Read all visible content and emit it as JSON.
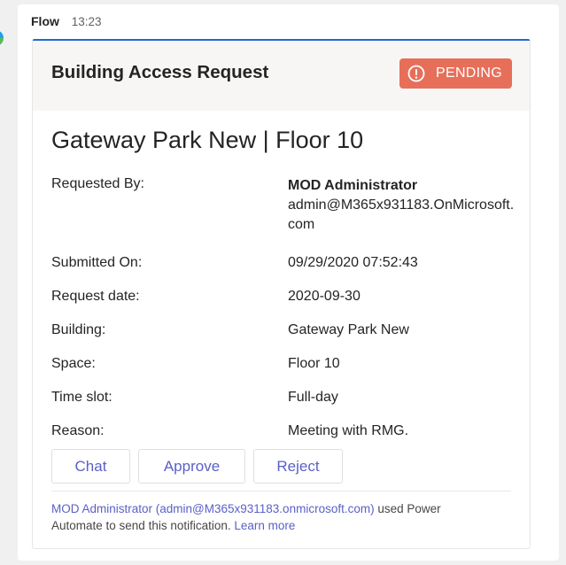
{
  "message": {
    "sender": "Flow",
    "time": "13:23"
  },
  "card": {
    "title": "Building Access Request",
    "status": {
      "label": "PENDING",
      "icon": "alert-circle-icon",
      "color": "#e76f5a"
    },
    "subject": "Gateway Park New | Floor 10",
    "facts": [
      {
        "label": "Requested By:",
        "value": "MOD Administrator",
        "value2": "admin@M365x931183.OnMicrosoft.com"
      },
      {
        "label": "Submitted On:",
        "value": "09/29/2020 07:52:43"
      },
      {
        "label": "Request date:",
        "value": "2020-09-30"
      },
      {
        "label": "Building:",
        "value": "Gateway Park New"
      },
      {
        "label": "Space:",
        "value": "Floor 10"
      },
      {
        "label": "Time slot:",
        "value": "Full-day"
      },
      {
        "label": "Reason:",
        "value": "Meeting with RMG."
      }
    ],
    "actions": [
      "Chat",
      "Approve",
      "Reject"
    ],
    "footer": {
      "sender_link": "MOD Administrator (admin@M365x931183.onmicrosoft.com)",
      "text": " used Power Automate to send this notification. ",
      "learn_more": "Learn more"
    }
  },
  "colors": {
    "accent": "#5b5fc7",
    "card_border_top": "#1b6ad2",
    "pending": "#e76f5a"
  }
}
